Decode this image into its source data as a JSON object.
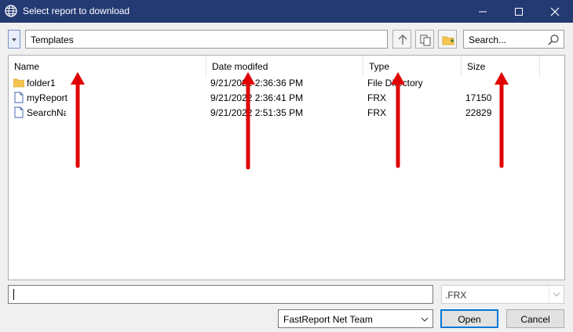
{
  "window": {
    "title": "Select report to download",
    "titlebar_color": "#243a73"
  },
  "toolbar": {
    "path": "Templates",
    "search_placeholder": "Search..."
  },
  "list": {
    "columns": [
      "Name",
      "Date modifed",
      "Type",
      "Size"
    ],
    "rows": [
      {
        "name": "folder1",
        "date": "9/21/2022 2:36:36 PM",
        "type": "File Directory",
        "size": "",
        "icon": "folder-icon"
      },
      {
        "name": "myReport",
        "date": "9/21/2022 2:36:41 PM",
        "type": "FRX",
        "size": "17150",
        "icon": "file-icon"
      },
      {
        "name": "SearchNam",
        "date": "9/21/2022 2:51:35 PM",
        "type": "FRX",
        "size": "22829",
        "icon": "file-icon"
      }
    ]
  },
  "footer": {
    "filename_value": "",
    "filter_value": ".FRX",
    "team_value": "FastReport Net Team",
    "open_label": "Open",
    "cancel_label": "Cancel"
  },
  "annotations": {
    "arrow_color": "#e00000"
  }
}
